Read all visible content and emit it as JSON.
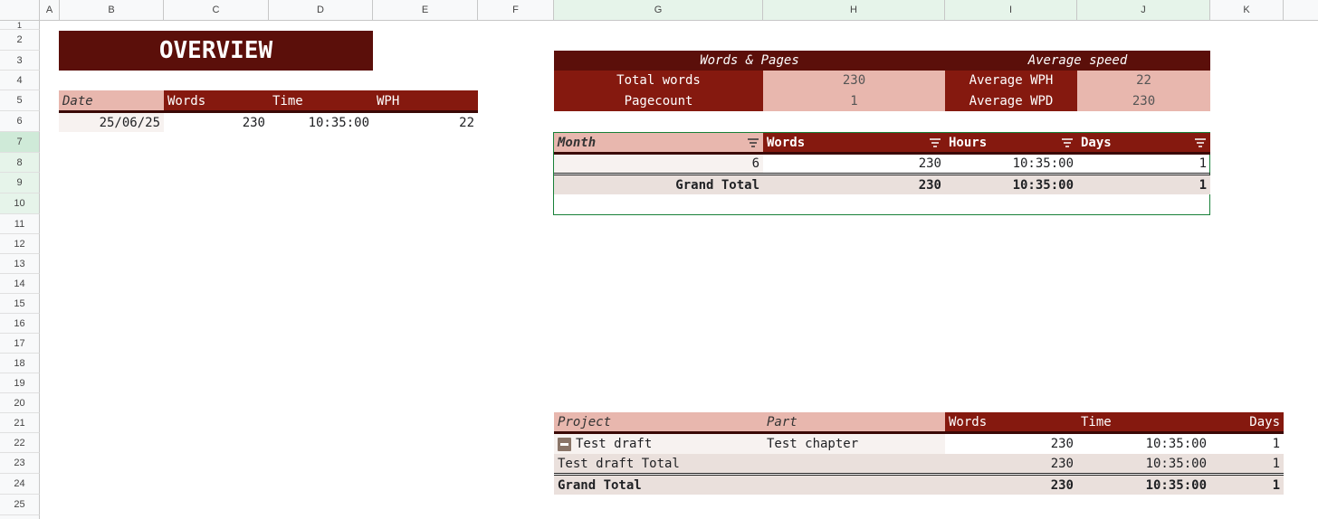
{
  "columns": [
    "A",
    "B",
    "C",
    "D",
    "E",
    "F",
    "G",
    "H",
    "I",
    "J",
    "K"
  ],
  "rows": [
    "1",
    "2",
    "3",
    "4",
    "5",
    "6",
    "7",
    "8",
    "9",
    "10",
    "11",
    "12",
    "13",
    "14",
    "15",
    "16",
    "17",
    "18",
    "19",
    "20",
    "21",
    "22",
    "23",
    "24",
    "25"
  ],
  "overview": {
    "title": "OVERVIEW",
    "headers": [
      "Date",
      "Words",
      "Time",
      "WPH"
    ],
    "row": {
      "date": "25/06/25",
      "words": "230",
      "time": "10:35:00",
      "wph": "22"
    }
  },
  "stats": {
    "left_header": "Words & Pages",
    "right_header": "Average speed",
    "total_words_label": "Total words",
    "total_words_value": "230",
    "pagecount_label": "Pagecount",
    "pagecount_value": "1",
    "avg_wph_label": "Average WPH",
    "avg_wph_value": "22",
    "avg_wpd_label": "Average WPD",
    "avg_wpd_value": "230"
  },
  "month_pivot": {
    "headers": [
      "Month",
      "Words",
      "Hours",
      "Days"
    ],
    "row": [
      "6",
      "230",
      "10:35:00",
      "1"
    ],
    "total": {
      "label": "Grand Total",
      "words": "230",
      "hours": "10:35:00",
      "days": "1"
    }
  },
  "project_pivot": {
    "headers": [
      "Project",
      "Part",
      "Words",
      "Time",
      "Days"
    ],
    "row": {
      "project": "Test draft",
      "part": "Test chapter",
      "words": "230",
      "time": "10:35:00",
      "days": "1"
    },
    "subtotal": {
      "label": "Test draft Total",
      "words": "230",
      "time": "10:35:00",
      "days": "1"
    },
    "total": {
      "label": "Grand Total",
      "words": "230",
      "time": "10:35:00",
      "days": "1"
    }
  },
  "colors": {
    "dark_red": "#5b0f0a",
    "red": "#85190f",
    "pink": "#e8b7ae",
    "beige": "#eae0dc",
    "selection": "#e6f4ea"
  },
  "icons": [
    "filter-icon",
    "collapse-minus-icon"
  ]
}
